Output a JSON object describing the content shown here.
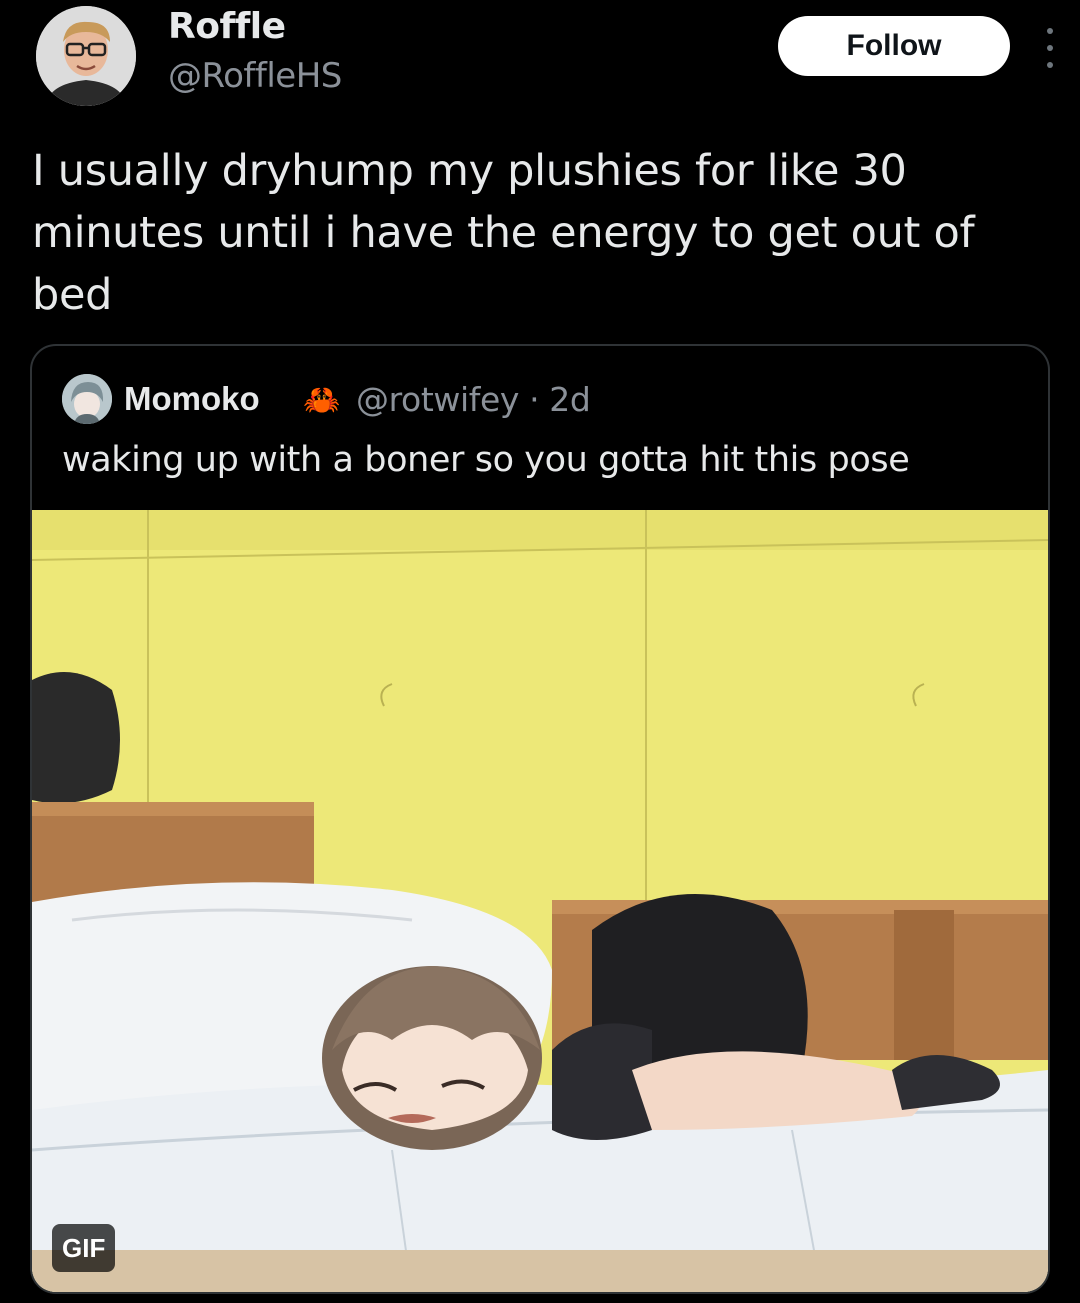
{
  "tweet": {
    "author_name": "Roffle",
    "author_handle": "@RoffleHS",
    "follow_label": "Follow",
    "text": "I usually dryhump my plushies for like 30 minutes until i have the energy to get out of bed"
  },
  "quote": {
    "author_name": "Momoko",
    "badge_emoji": "🦀",
    "handle_time": "@rotwifey · 2d",
    "text": "waking up with a boner so you gotta hit this pose",
    "media_badge": "GIF"
  },
  "colors": {
    "background": "#000000",
    "text_primary": "#e7e9ea",
    "text_secondary": "#8b9199",
    "follow_button_bg": "#ffffff",
    "card_border": "#2f3336",
    "wall_yellow": "#ede878"
  },
  "icons": {
    "more": "vertical-ellipsis-icon"
  }
}
